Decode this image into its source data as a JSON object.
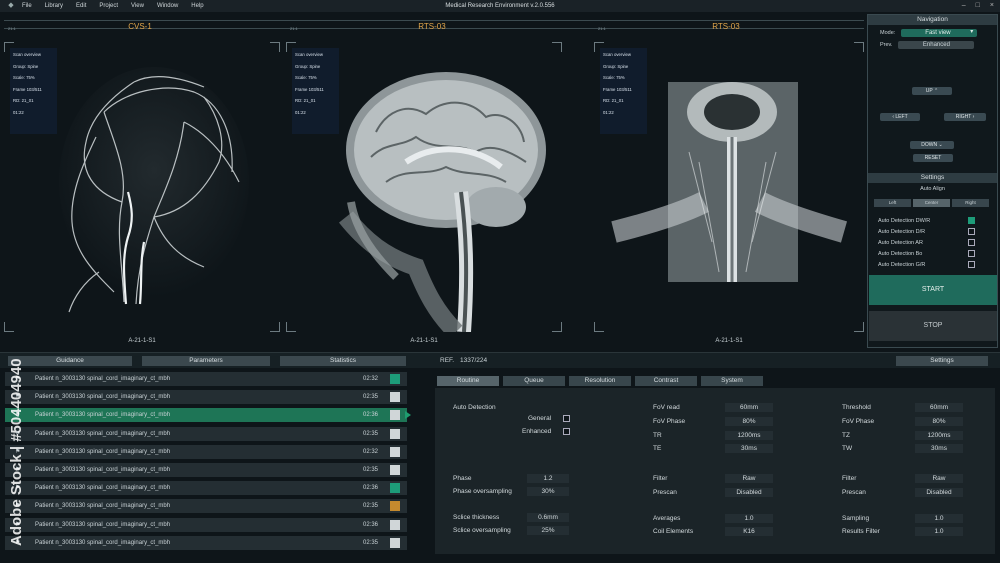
{
  "menubar": {
    "items": [
      "File",
      "Library",
      "Edit",
      "Project",
      "View",
      "Window",
      "Help"
    ],
    "title": "Medical Research Environment v.2.0.556"
  },
  "viewports": [
    {
      "header": "CVS-1",
      "corner": "21:1",
      "info": [
        "Scan overview",
        "Group: Spine",
        "Scale: 75%",
        "Frame 103/511",
        "RD: 21_01",
        "01:22"
      ],
      "label": "A-21-1-S1"
    },
    {
      "header": "RTS-03",
      "corner": "21:1",
      "info": [
        "Scan overview",
        "Group: Spine",
        "Scale: 75%",
        "Frame 103/511",
        "RD: 21_01",
        "01:22"
      ],
      "label": "A-21-1-S1"
    },
    {
      "header": "RTS-03",
      "corner": "21:1",
      "info": [
        "Scan overview",
        "Group: Spine",
        "Scale: 75%",
        "Frame 103/511",
        "RD: 21_01",
        "01:22"
      ],
      "label": "A-21-1-S1"
    }
  ],
  "navigation": {
    "title": "Navigation",
    "mode_label": "Mode:",
    "mode_value": "Fast view",
    "prev_label": "Prev.",
    "prev_value": "Enhanced",
    "up": "UP",
    "left": "LEFT",
    "right": "RIGHT",
    "down": "DOWN",
    "reset": "RESET"
  },
  "settings_panel": {
    "title": "Settings",
    "auto_align": "Auto Align",
    "align_options": [
      "Left",
      "Center",
      "Right"
    ],
    "detections": [
      {
        "label": "Auto Detection DW/R",
        "checked": true
      },
      {
        "label": "Auto Detection D/R",
        "checked": false
      },
      {
        "label": "Auto Detection AR",
        "checked": false
      },
      {
        "label": "Auto Detection Bo",
        "checked": false
      },
      {
        "label": "Auto Detection G/R",
        "checked": false
      }
    ],
    "start": "START",
    "stop": "STOP"
  },
  "lower": {
    "tabs": [
      "Guidance",
      "Parameters",
      "Statistics"
    ],
    "ref_label": "REF.",
    "ref_value": "1337/224",
    "settings": "Settings"
  },
  "patients": [
    {
      "name": "Patient n_3003130 spinal_cord_imaginary_ct_mbh",
      "time": "02:32",
      "status": "#1d9c79",
      "selected": false
    },
    {
      "name": "Patient n_3003130 spinal_cord_imaginary_ct_mbh",
      "time": "02:35",
      "status": "#d0d6d8",
      "selected": false
    },
    {
      "name": "Patient n_3003130 spinal_cord_imaginary_ct_mbh",
      "time": "02:36",
      "status": "#d0d6d8",
      "selected": true
    },
    {
      "name": "Patient n_3003130 spinal_cord_imaginary_ct_mbh",
      "time": "02:35",
      "status": "#d0d6d8",
      "selected": false
    },
    {
      "name": "Patient n_3003130 spinal_cord_imaginary_ct_mbh",
      "time": "02:32",
      "status": "#d0d6d8",
      "selected": false
    },
    {
      "name": "Patient n_3003130 spinal_cord_imaginary_ct_mbh",
      "time": "02:35",
      "status": "#d0d6d8",
      "selected": false
    },
    {
      "name": "Patient n_3003130 spinal_cord_imaginary_ct_mbh",
      "time": "02:36",
      "status": "#1d9c79",
      "selected": false
    },
    {
      "name": "Patient n_3003130 spinal_cord_imaginary_ct_mbh",
      "time": "02:35",
      "status": "#c58a2e",
      "selected": false
    },
    {
      "name": "Patient n_3003130 spinal_cord_imaginary_ct_mbh",
      "time": "02:36",
      "status": "#d0d6d8",
      "selected": false
    },
    {
      "name": "Patient n_3003130 spinal_cord_imaginary_ct_mbh",
      "time": "02:35",
      "status": "#d0d6d8",
      "selected": false
    }
  ],
  "param_tabs": [
    "Routine",
    "Queue",
    "Resolution",
    "Contrast",
    "System"
  ],
  "params": {
    "auto_detection": "Auto Detection",
    "general": "General",
    "enhanced": "Enhanced",
    "phase": "Phase",
    "phase_v": "1.2",
    "phase_os": "Phase oversampling",
    "phase_os_v": "30%",
    "slice_thick": "Sclice thickness",
    "slice_thick_v": "0.6mm",
    "slice_os": "Sclice oversampling",
    "slice_os_v": "25%",
    "fov_read": "FoV read",
    "fov_read_v": "60mm",
    "fov_phase": "FoV Phase",
    "fov_phase_v": "80%",
    "tr": "TR",
    "tr_v": "1200ms",
    "te": "TE",
    "te_v": "30ms",
    "filter": "Filter",
    "filter_v": "Raw",
    "prescan": "Prescan",
    "prescan_v": "Disabled",
    "averages": "Averages",
    "averages_v": "1.0",
    "coil": "Coil Elements",
    "coil_v": "K16",
    "threshold": "Threshold",
    "threshold_v": "60mm",
    "fov_phase2": "FoV Phase",
    "fov_phase2_v": "80%",
    "tz": "TZ",
    "tz_v": "1200ms",
    "tw": "TW",
    "tw_v": "30ms",
    "filter2": "Filter",
    "filter2_v": "Raw",
    "prescan2": "Prescan",
    "prescan2_v": "Disabled",
    "sampling": "Sampling",
    "sampling_v": "1.0",
    "results": "Results Filter",
    "results_v": "1.0"
  },
  "watermark": "Adobe Stock | #504404940"
}
